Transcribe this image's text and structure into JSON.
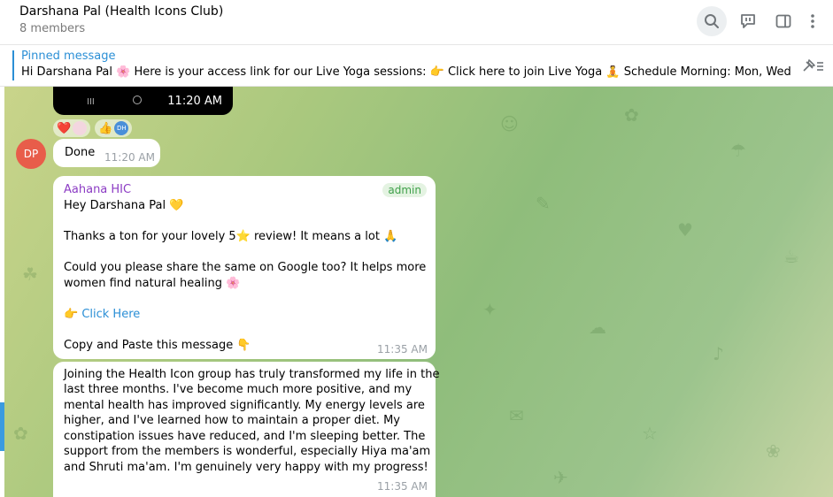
{
  "header": {
    "title": "Darshana Pal (Health Icons Club)",
    "subtitle": "8 members"
  },
  "pinned": {
    "label": "Pinned message",
    "text": "Hi Darshana Pal 🌸  Here is your access link for our Live Yoga sessions: 👉 Click here to join Live Yoga  🧘 Schedule Morning: Mon, Wed, Fri ..."
  },
  "messages": {
    "video": {
      "time": "11:20 AM",
      "nav_menu": "III"
    },
    "reactions": [
      {
        "emoji": "❤️"
      },
      {
        "emoji": "👍",
        "avatar": "DH"
      }
    ],
    "done": {
      "avatar": "DP",
      "text": "Done",
      "time": "11:20 AM"
    },
    "main": {
      "sender": "Aahana HIC",
      "badge": "admin",
      "greeting": "Hey Darshana Pal 💛",
      "thanks": "Thanks a ton for your lovely 5⭐ review! It means a lot 🙏",
      "ask_1": "Could you please share the same on Google too? It helps more",
      "ask_2": "women find natural healing 🌸",
      "link_prefix": "👉",
      "link": "Click Here",
      "copy": "Copy and Paste this message 👇",
      "time": "11:35 AM"
    },
    "testimonial": {
      "lines": [
        "Joining the Health Icon group has truly transformed my life in the",
        "last three months. I've become much more positive, and my",
        "mental health has improved significantly. My energy levels are",
        "higher, and I've learned how to maintain a proper diet. My",
        "constipation issues have reduced, and I'm sleeping better. The",
        "support from the members is wonderful, especially Hiya ma'am",
        "and Shruti ma'am. I'm genuinely very happy with my progress!"
      ],
      "time": "11:35 AM"
    }
  },
  "icons": {
    "search": "search-icon",
    "live": "live-chat-icon",
    "sidebar": "sidebar-toggle-icon",
    "more": "more-vertical-icon",
    "unpin": "unpin-icon"
  },
  "colors": {
    "accent": "#2b8fd6",
    "admin_sender": "#8c3cc4",
    "admin_badge": "#3fa04a",
    "avatar_dp": "#e85d4a",
    "timestamp": "#9aa0a6"
  }
}
